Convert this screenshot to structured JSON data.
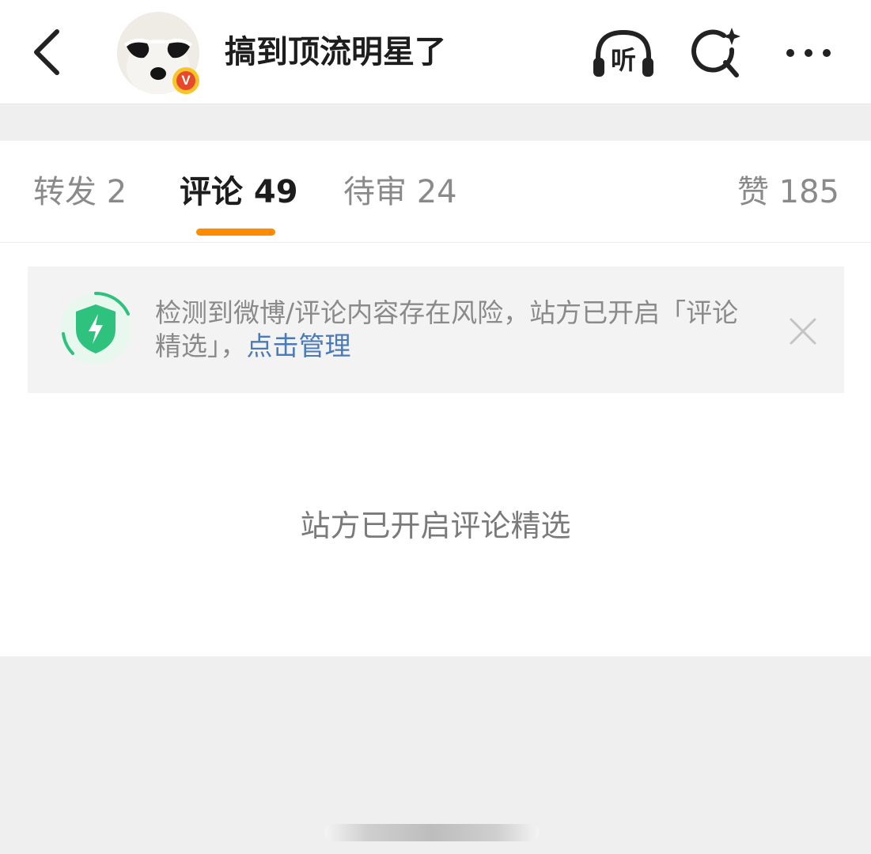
{
  "header": {
    "title": "搞到顶流明星了",
    "avatar_badge": "V",
    "listen_icon_text": "听",
    "icons": [
      "back-icon",
      "listen-icon",
      "search-icon",
      "more-icon"
    ]
  },
  "tabs": [
    {
      "label": "转发 2",
      "active": false
    },
    {
      "label": "评论 49",
      "active": true
    },
    {
      "label": "待审 24",
      "active": false
    },
    {
      "label": "赞 185",
      "active": false
    }
  ],
  "notice": {
    "text": "检测到微博/评论内容存在风险，站方已开启「评论精选」，",
    "link": "点击管理"
  },
  "empty_state": {
    "text": "站方已开启评论精选"
  },
  "colors": {
    "accent": "#ff8c00",
    "link": "#4a7ab8",
    "shield": "#2ec27e",
    "badge_outer": "#f7c52a",
    "badge_inner": "#e8492a"
  }
}
